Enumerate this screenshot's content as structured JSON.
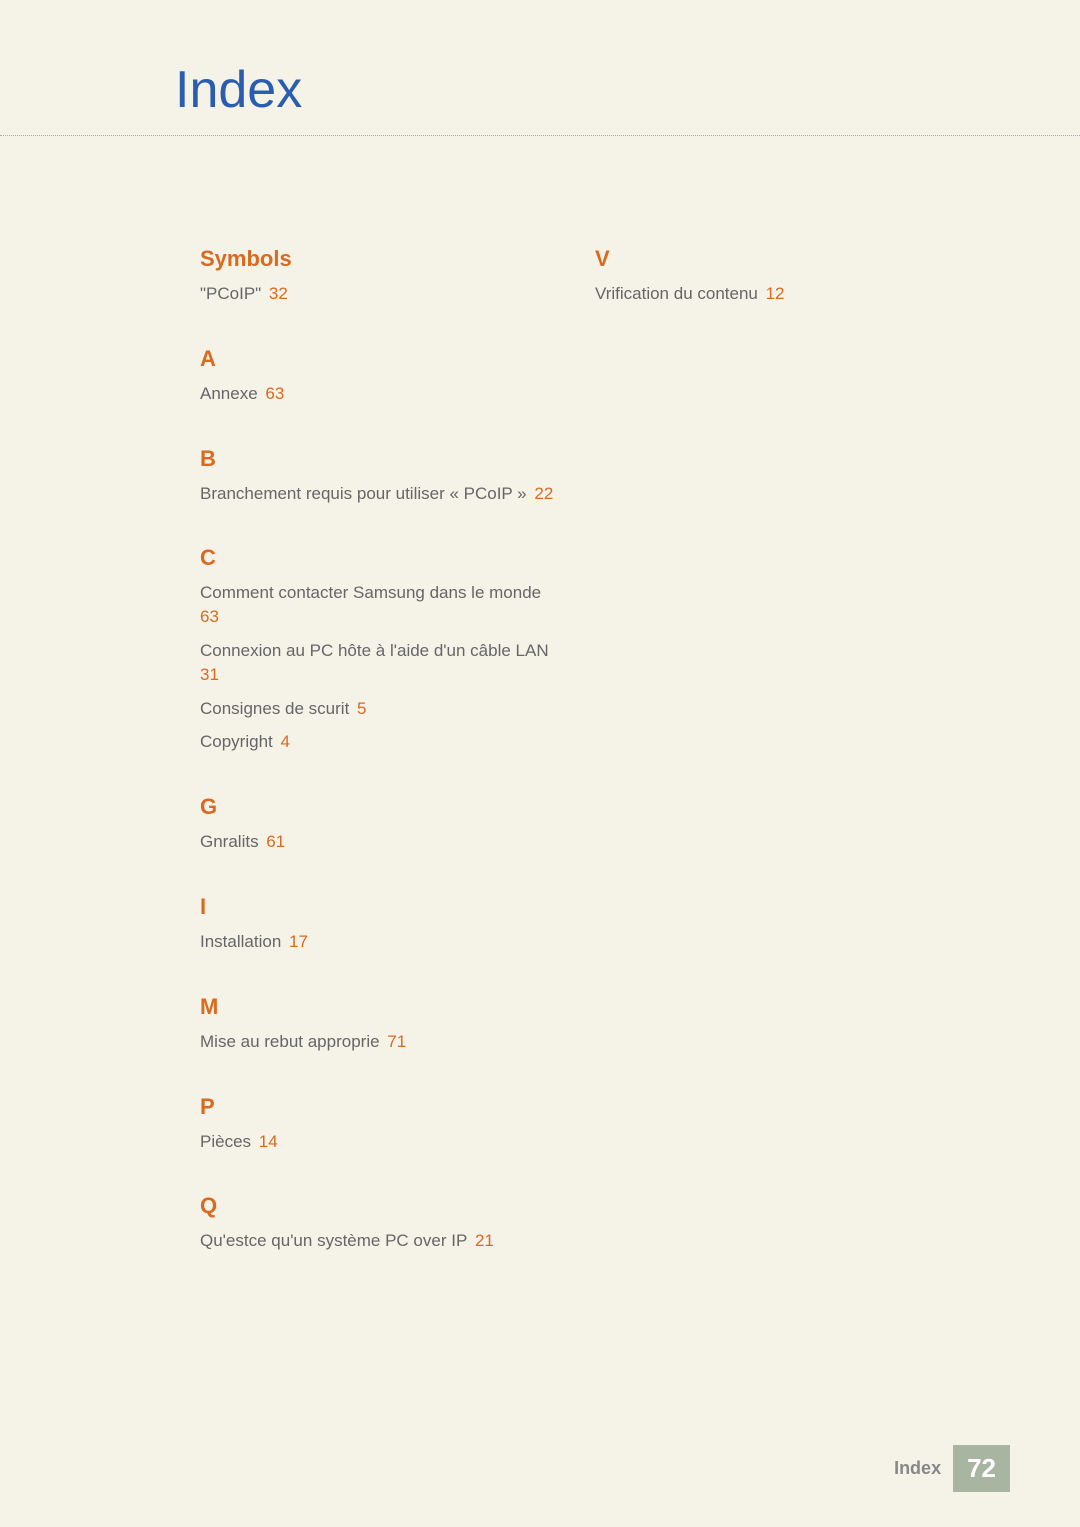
{
  "page_title": "Index",
  "columns": {
    "left": [
      {
        "heading": "Symbols",
        "entries": [
          {
            "text": "\"PCoIP\"",
            "page": "32"
          }
        ]
      },
      {
        "heading": "A",
        "entries": [
          {
            "text": "Annexe",
            "page": "63"
          }
        ]
      },
      {
        "heading": "B",
        "entries": [
          {
            "text": "Branchement requis pour utiliser « PCoIP »",
            "page": "22"
          }
        ]
      },
      {
        "heading": "C",
        "entries": [
          {
            "text": "Comment contacter Samsung dans le monde",
            "page": "63"
          },
          {
            "text": "Connexion au PC hôte à l'aide d'un câble LAN",
            "page": "31"
          },
          {
            "text": "Consignes de scurit",
            "page": "5"
          },
          {
            "text": "Copyright",
            "page": "4"
          }
        ]
      },
      {
        "heading": "G",
        "entries": [
          {
            "text": "Gnralits",
            "page": "61"
          }
        ]
      },
      {
        "heading": "I",
        "entries": [
          {
            "text": "Installation",
            "page": "17"
          }
        ]
      },
      {
        "heading": "M",
        "entries": [
          {
            "text": "Mise au rebut approprie",
            "page": "71"
          }
        ]
      },
      {
        "heading": "P",
        "entries": [
          {
            "text": "Pièces",
            "page": "14"
          }
        ]
      },
      {
        "heading": "Q",
        "entries": [
          {
            "text": "Qu'estce qu'un système PC over IP",
            "page": "21"
          }
        ]
      }
    ],
    "right": [
      {
        "heading": "V",
        "entries": [
          {
            "text": "Vrification du contenu",
            "page": "12"
          }
        ]
      }
    ]
  },
  "footer": {
    "label": "Index",
    "page_number": "72"
  }
}
